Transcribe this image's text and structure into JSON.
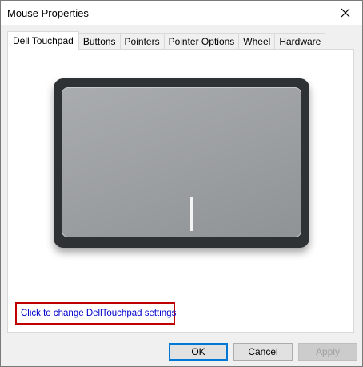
{
  "window": {
    "title": "Mouse Properties",
    "close_icon": "close-icon"
  },
  "tabs": [
    {
      "label": "Dell Touchpad",
      "active": true
    },
    {
      "label": "Buttons",
      "active": false
    },
    {
      "label": "Pointers",
      "active": false
    },
    {
      "label": "Pointer Options",
      "active": false
    },
    {
      "label": "Wheel",
      "active": false
    },
    {
      "label": "Hardware",
      "active": false
    }
  ],
  "panel": {
    "link_text": "Click to change DellTouchpad settings"
  },
  "buttons": {
    "ok": "OK",
    "cancel": "Cancel",
    "apply": "Apply"
  },
  "colors": {
    "link": "#0000cc",
    "highlight_box": "#c00000",
    "focus": "#0078d7"
  }
}
